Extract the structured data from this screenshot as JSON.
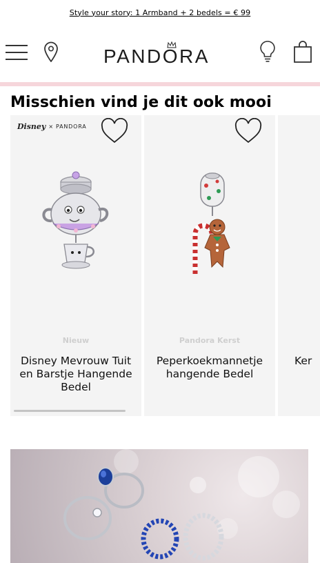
{
  "promo": {
    "text": "Style your story: 1 Armband + 2 bedels = € 99"
  },
  "header": {
    "logo": "PANDORA",
    "icons": [
      "menu-icon",
      "location-pin-icon",
      "lightbulb-icon",
      "shopping-bag-icon"
    ]
  },
  "recommendations": {
    "title": "Misschien vind je dit ook mooi",
    "products": [
      {
        "badge": {
          "brand": "Disney",
          "sep": "×",
          "partner": "PANDORA"
        },
        "tag": "Nieuw",
        "name": "Disney Mevrouw Tuit en Barstje Hangende Bedel"
      },
      {
        "tag": "Pandora Kerst",
        "name": "Peperkoekmannetje hangende Bedel"
      },
      {
        "tag": "",
        "name": "Ker"
      }
    ]
  },
  "colors": {
    "accent_bar": "#f6d6db",
    "card_bg": "#f4f4f4"
  }
}
